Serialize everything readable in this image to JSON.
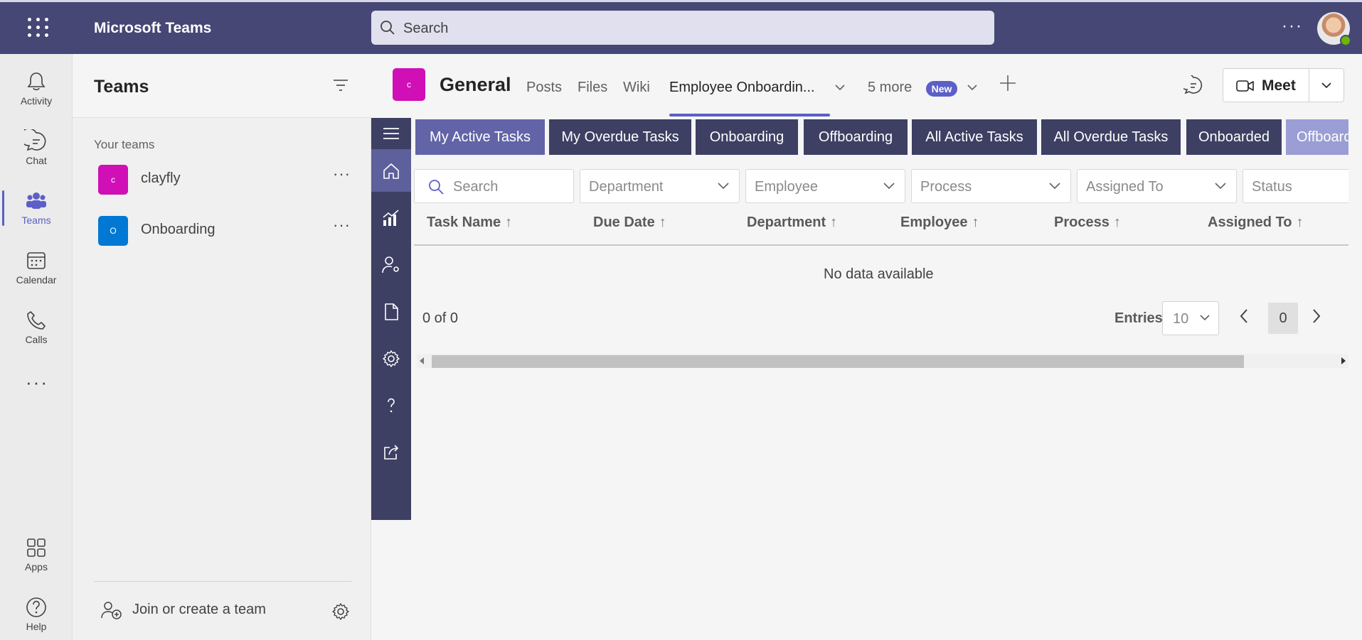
{
  "topbar": {
    "app_title": "Microsoft Teams",
    "search_placeholder": "Search",
    "more": "···",
    "accent": "#464775"
  },
  "rail": {
    "items": [
      {
        "label": "Activity",
        "icon": "bell-icon"
      },
      {
        "label": "Chat",
        "icon": "chat-icon"
      },
      {
        "label": "Teams",
        "icon": "teams-icon",
        "active": true
      },
      {
        "label": "Calendar",
        "icon": "calendar-icon"
      },
      {
        "label": "Calls",
        "icon": "phone-icon"
      }
    ],
    "more": "···",
    "bottom": [
      {
        "label": "Apps",
        "icon": "apps-icon"
      },
      {
        "label": "Help",
        "icon": "help-icon"
      }
    ]
  },
  "teams_pane": {
    "title": "Teams",
    "section": "Your teams",
    "teams": [
      {
        "badge": "c",
        "name": "clayfly",
        "color": "#d00fb6"
      },
      {
        "badge": "O",
        "name": "Onboarding",
        "color": "#0078d4"
      }
    ],
    "more": "···",
    "join_label": "Join or create a team"
  },
  "channel": {
    "badge": "c",
    "title": "General",
    "tabs": [
      "Posts",
      "Files",
      "Wiki",
      "Employee Onboardin..."
    ],
    "more_tabs": "5 more",
    "new_badge": "New",
    "meet_label": "Meet"
  },
  "app": {
    "tabs": [
      "My Active Tasks",
      "My Overdue Tasks",
      "Onboarding",
      "Offboarding",
      "All Active Tasks",
      "All Overdue Tasks",
      "Onboarded",
      "Offboarded"
    ],
    "active_tab": "My Active Tasks",
    "filters": {
      "search_placeholder": "Search",
      "department": "Department",
      "employee": "Employee",
      "process": "Process",
      "assigned_to": "Assigned To",
      "status": "Status"
    },
    "columns": [
      "Task Name",
      "Due Date",
      "Department",
      "Employee",
      "Process",
      "Assigned To"
    ],
    "sort_arrow": "↑",
    "empty_message": "No data available",
    "count": "0 of 0",
    "entries_label": "Entries",
    "entries_value": "10",
    "page": "0",
    "nav_colors": {
      "bar": "#3d3f63",
      "active": "#6264a7"
    }
  }
}
